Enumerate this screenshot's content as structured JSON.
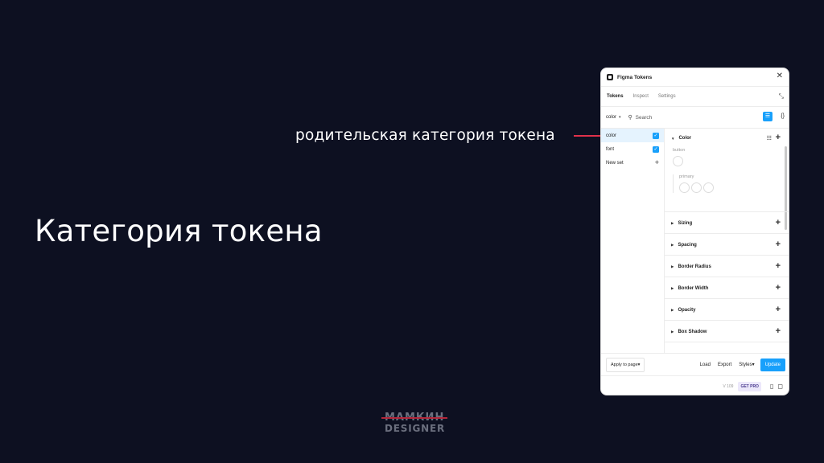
{
  "slide": {
    "title": "Категория токена",
    "annotation": "родительская категория токена"
  },
  "logo": {
    "top": "МАМКИН",
    "bottom": "DESIGNER"
  },
  "colors": {
    "background": "#0d1021",
    "accent": "#18a0fb",
    "pointer": "#e0314b"
  },
  "plugin": {
    "title": "Figma Tokens",
    "tabs": [
      "Tokens",
      "Inspect",
      "Settings"
    ],
    "token_set_select": "color",
    "search_placeholder": "Search",
    "sets": [
      {
        "name": "color",
        "checked": true
      },
      {
        "name": "font",
        "checked": true
      }
    ],
    "new_set": "New set",
    "color_group": {
      "title": "Color",
      "subgroups": [
        {
          "label": "button",
          "swatches": 1
        },
        {
          "label": "primary",
          "swatches": 3
        }
      ]
    },
    "groups": [
      "Sizing",
      "Spacing",
      "Border Radius",
      "Border Width",
      "Opacity",
      "Box Shadow"
    ],
    "footer": {
      "apply": "Apply to page",
      "load": "Load",
      "export": "Export",
      "styles": "Styles",
      "update": "Update"
    },
    "status": {
      "version": "V 109",
      "pro": "GET PRO"
    }
  }
}
